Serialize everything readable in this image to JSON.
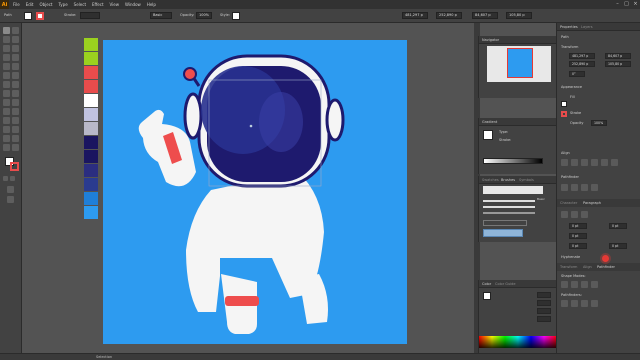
{
  "app": {
    "logo": "Ai"
  },
  "menu": [
    "File",
    "Edit",
    "Object",
    "Type",
    "Select",
    "Effect",
    "View",
    "Window",
    "Help"
  ],
  "window_controls": [
    "–",
    "□",
    "×"
  ],
  "control_bar": {
    "selection_label": "Path",
    "stroke_label": "Stroke:",
    "stroke_value": "",
    "brush_label": "Basic",
    "opacity_label": "Opacity:",
    "opacity_value": "100%",
    "style_label": "Style:",
    "x_value": "481,297 p",
    "y_value": "252,890 p",
    "w_value": "84,607 p",
    "h_value": "105,80 p"
  },
  "colors": {
    "artboard": "#2d9bf0",
    "helmet_dark": "#1e1a6e",
    "visor": "#28318f",
    "suit": "#f5f5f5",
    "accent_red": "#ee4d4d",
    "swatches": [
      "#9bd11f",
      "#9bd11f",
      "#e84c4c",
      "#e84c4c",
      "#ffffff",
      "#c0c2e0",
      "#b8b8c8",
      "#1a1560",
      "#1a1560",
      "#2b2d80",
      "#2a3b8f",
      "#1f7fd8",
      "#2d9bf0"
    ]
  },
  "navigator": {
    "title": "Navigator"
  },
  "gradient": {
    "title": "Gradient",
    "type_label": "Type:",
    "stroke_label": "Stroke:"
  },
  "brushes": {
    "tabs": [
      "Swatches",
      "Brushes",
      "Symbols"
    ],
    "basic_label": "Basic",
    "size_value": "5.00"
  },
  "color": {
    "tabs": [
      "Color",
      "Color Guide"
    ]
  },
  "properties": {
    "tabs": [
      "Properties",
      "Layers"
    ],
    "path_label": "Path",
    "transform_label": "Transform",
    "x_value": "481,297 p",
    "y_value": "252,890 p",
    "w_value": "84,607 p",
    "h_value": "105,80 p",
    "rotate_value": "0°",
    "appearance_label": "Appearance",
    "fill_label": "Fill",
    "stroke_label": "Stroke",
    "opacity_label": "Opacity",
    "opacity_value": "100%",
    "align_label": "Align",
    "pathfinder_label": "Pathfinder",
    "char_tabs": [
      "Character",
      "Paragraph"
    ],
    "para_values": [
      "0 pt",
      "0 pt",
      "0 pt",
      "0 pt",
      "0 pt"
    ],
    "hyphenate_label": "Hyphenate",
    "bottom_tabs": [
      "Transform",
      "Align",
      "Pathfinder"
    ],
    "shape_modes_label": "Shape Modes:",
    "pathfinders_label": "Pathfinders:"
  },
  "status": {
    "zoom": "",
    "tool": "Selection"
  }
}
